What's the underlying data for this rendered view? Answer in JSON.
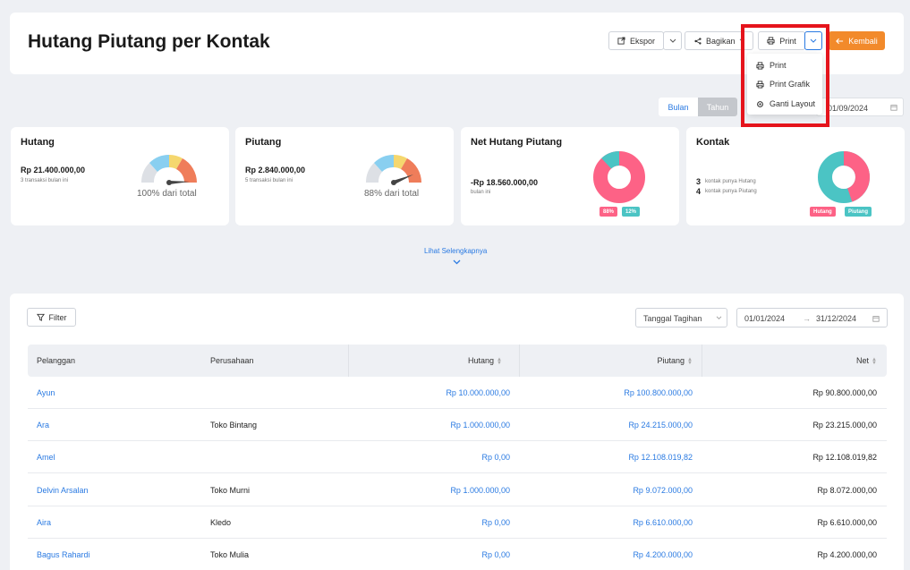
{
  "header": {
    "title": "Hutang Piutang per Kontak",
    "ekspor_label": "Ekspor",
    "bagikan_label": "Bagikan",
    "print_label": "Print",
    "kembali_label": "Kembali"
  },
  "print_menu": {
    "items": [
      {
        "label": "Print",
        "icon": "printer-icon"
      },
      {
        "label": "Print Grafik",
        "icon": "printer-icon"
      },
      {
        "label": "Ganti Layout",
        "icon": "gear-icon"
      }
    ]
  },
  "period_toggle": {
    "bulan": "Bulan",
    "tahun": "Tahun",
    "selected": "Tahun"
  },
  "top_date": "01/09/2024",
  "cards": {
    "hutang": {
      "title": "Hutang",
      "amount": "Rp 21.400.000,00",
      "sub": "3 transaksi bulan ini",
      "gauge_label": "100% dari total",
      "gauge_fraction": 1.0
    },
    "piutang": {
      "title": "Piutang",
      "amount": "Rp 2.840.000,00",
      "sub": "5 transaksi bulan ini",
      "gauge_label": "88% dari total",
      "gauge_fraction": 0.88
    },
    "net": {
      "title": "Net Hutang Piutang",
      "amount": "-Rp 18.560.000,00",
      "sub": "bulan ini",
      "donut": [
        88,
        12
      ],
      "badge1": "88%",
      "badge2": "12%"
    },
    "kontak": {
      "title": "Kontak",
      "hutang_count": "3",
      "hutang_text": "kontak punya Hutang",
      "piutang_count": "4",
      "piutang_text": "kontak punya Piutang",
      "legend_hutang": "Hutang",
      "legend_piutang": "Piutang",
      "donut": [
        43,
        57
      ]
    }
  },
  "see_more": "Lihat Selengkapnya",
  "filters": {
    "filter_label": "Filter",
    "date_type": "Tanggal Tagihan",
    "date_from": "01/01/2024",
    "arrow": "→",
    "date_to": "31/12/2024"
  },
  "table": {
    "columns": [
      "Pelanggan",
      "Perusahaan",
      "Hutang",
      "Piutang",
      "Net"
    ],
    "rows": [
      {
        "pelanggan": "Ayun",
        "perusahaan": "",
        "hutang": "Rp 10.000.000,00",
        "piutang": "Rp 100.800.000,00",
        "net": "Rp 90.800.000,00"
      },
      {
        "pelanggan": "Ara",
        "perusahaan": "Toko Bintang",
        "hutang": "Rp 1.000.000,00",
        "piutang": "Rp 24.215.000,00",
        "net": "Rp 23.215.000,00"
      },
      {
        "pelanggan": "Amel",
        "perusahaan": "",
        "hutang": "Rp 0,00",
        "piutang": "Rp 12.108.019,82",
        "net": "Rp 12.108.019,82"
      },
      {
        "pelanggan": "Delvin Arsalan",
        "perusahaan": "Toko Murni",
        "hutang": "Rp 1.000.000,00",
        "piutang": "Rp 9.072.000,00",
        "net": "Rp 8.072.000,00"
      },
      {
        "pelanggan": "Aira",
        "perusahaan": "Kledo",
        "hutang": "Rp 0,00",
        "piutang": "Rp 6.610.000,00",
        "net": "Rp 6.610.000,00"
      },
      {
        "pelanggan": "Bagus Rahardi",
        "perusahaan": "Toko Mulia",
        "hutang": "Rp 0,00",
        "piutang": "Rp 4.200.000,00",
        "net": "Rp 4.200.000,00"
      }
    ]
  },
  "colors": {
    "accent": "#2a7ae2",
    "orange": "#f28a2b",
    "pink": "#fd6286",
    "teal": "#4bc4c4",
    "highlight": "#e5141c"
  }
}
